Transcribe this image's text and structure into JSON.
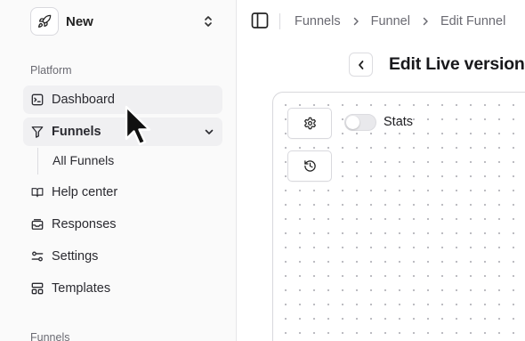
{
  "team": {
    "name": "New",
    "logo_icon": "rocket-icon",
    "switch_icon": "chevrons-up-down-icon"
  },
  "sidebar": {
    "platform_label": "Platform",
    "items": [
      {
        "label": "Dashboard",
        "icon": "dashboard-icon"
      },
      {
        "label": "Funnels",
        "icon": "funnel-icon",
        "expanded": true,
        "sub_items": [
          {
            "label": "All Funnels"
          }
        ]
      },
      {
        "label": "Help center",
        "icon": "book-icon"
      },
      {
        "label": "Responses",
        "icon": "inbox-icon"
      },
      {
        "label": "Settings",
        "icon": "sliders-icon"
      },
      {
        "label": "Templates",
        "icon": "layout-icon"
      }
    ],
    "funnels_label": "Funnels"
  },
  "header": {
    "breadcrumbs": [
      "Funnels",
      "Funnel",
      "Edit Funnel"
    ]
  },
  "page": {
    "title": "Edit Live version"
  },
  "canvas": {
    "stats_label": "Stats",
    "stats_enabled": false
  },
  "colors": {
    "sidebar_bg": "#fafafa",
    "active_item_bg": "#f0f0f2",
    "text": "#1f1f23",
    "muted": "#6b6b73"
  }
}
